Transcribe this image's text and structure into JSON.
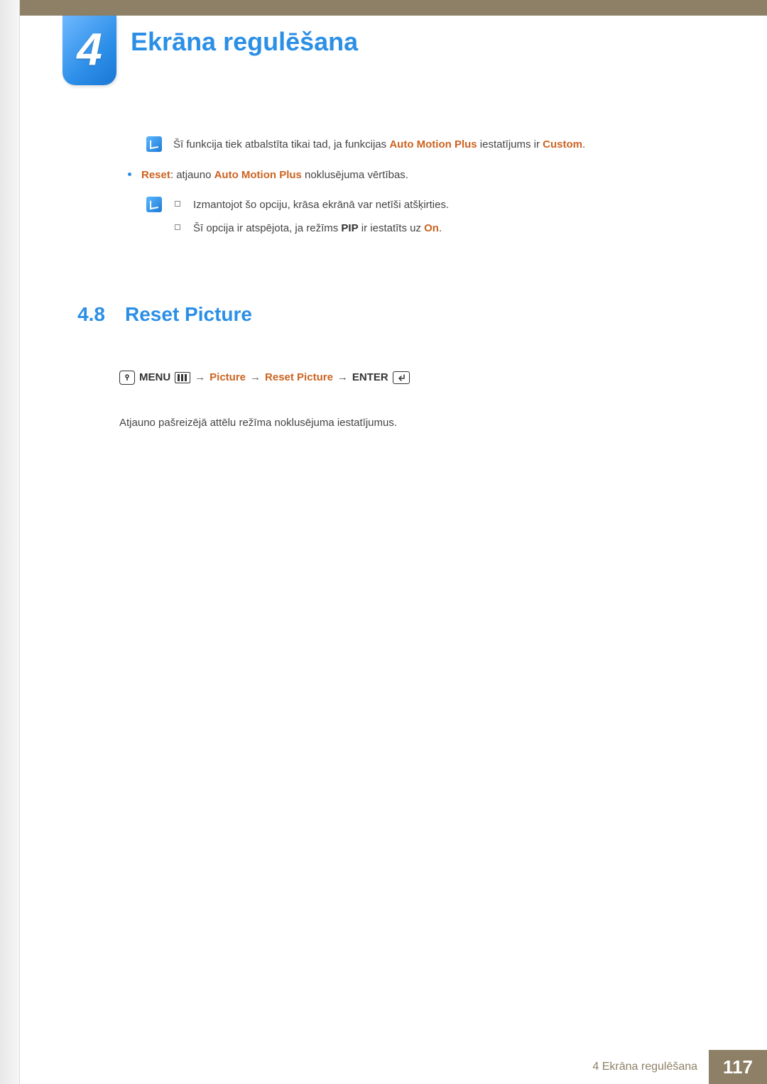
{
  "chapter": {
    "number": "4",
    "title": "Ekrāna regulēšana"
  },
  "note1": {
    "prefix": "Šī funkcija tiek atbalstīta tikai tad, ja funkcijas ",
    "term1": "Auto Motion Plus",
    "middle": " iestatījums ir ",
    "term2": "Custom",
    "suffix": "."
  },
  "bullet": {
    "term_reset": "Reset",
    "colon": ": atjauno ",
    "term_amp": "Auto Motion Plus",
    "suffix": " noklusējuma vērtības."
  },
  "sublist": {
    "item1": "Izmantojot šo opciju, krāsa ekrānā var netīši atšķirties.",
    "item2_prefix": "Šī opcija ir atspējota, ja režīms ",
    "item2_term1": "PIP",
    "item2_middle": " ir iestatīts uz ",
    "item2_term2": "On",
    "item2_suffix": "."
  },
  "section": {
    "number": "4.8",
    "title": "Reset Picture"
  },
  "menupath": {
    "menu": "MENU",
    "picture": "Picture",
    "reset_picture": "Reset Picture",
    "enter": "ENTER"
  },
  "body": "Atjauno pašreizējā attēlu režīma noklusējuma iestatījumus.",
  "footer": {
    "chapter_label": "4 Ekrāna regulēšana",
    "page": "117"
  }
}
